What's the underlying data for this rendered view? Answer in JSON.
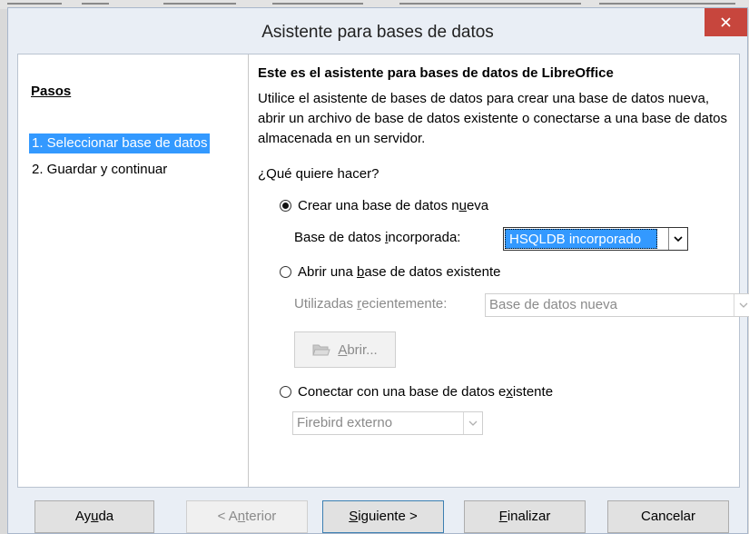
{
  "window": {
    "title": "Asistente para bases de datos",
    "close_glyph": "✕"
  },
  "steps": {
    "heading": "Pasos",
    "items": [
      {
        "label": "1. Seleccionar base de datos",
        "active": true
      },
      {
        "label": "2. Guardar y continuar",
        "active": false
      }
    ]
  },
  "main": {
    "heading": "Este es el asistente para bases de datos de LibreOffice",
    "description": "Utilice el asistente de bases de datos para crear una base de datos nueva, abrir un archivo de base de datos existente o conectarse a una base de datos almacenada en un servidor.",
    "question": "¿Qué quiere hacer?",
    "option_create": {
      "label_pre": "Crear una base de datos n",
      "mnemonic": "u",
      "label_post": "eva",
      "checked": true
    },
    "embedded_label": {
      "pre": "Base de datos ",
      "mnemonic": "i",
      "post": "ncorporada:"
    },
    "embedded_value": "HSQLDB incorporado",
    "option_open": {
      "label_pre": "Abrir una ",
      "mnemonic": "b",
      "label_post": "ase de datos existente",
      "checked": false
    },
    "recent_label": {
      "pre": "Utilizadas ",
      "mnemonic": "r",
      "post": "ecientemente:"
    },
    "recent_value": "Base de datos nueva",
    "open_button": {
      "mnemonic": "A",
      "post": "brir..."
    },
    "option_connect": {
      "label_pre": "Conectar con una base de datos e",
      "mnemonic": "x",
      "label_post": "istente",
      "checked": false
    },
    "connect_value": "Firebird externo"
  },
  "buttons": {
    "help": {
      "pre": "Ay",
      "mnemonic": "u",
      "post": "da"
    },
    "prev": {
      "pre": "< A",
      "mnemonic": "n",
      "post": "terior"
    },
    "next": {
      "pre": "",
      "mnemonic": "S",
      "post": "iguiente >"
    },
    "finish": {
      "pre": "",
      "mnemonic": "F",
      "post": "inalizar"
    },
    "cancel": {
      "pre": "",
      "mnemonic": "",
      "post": "Cancelar"
    }
  },
  "colors": {
    "selection": "#3399ff",
    "close": "#c7463d",
    "disabled_text": "#8a8a8a"
  }
}
